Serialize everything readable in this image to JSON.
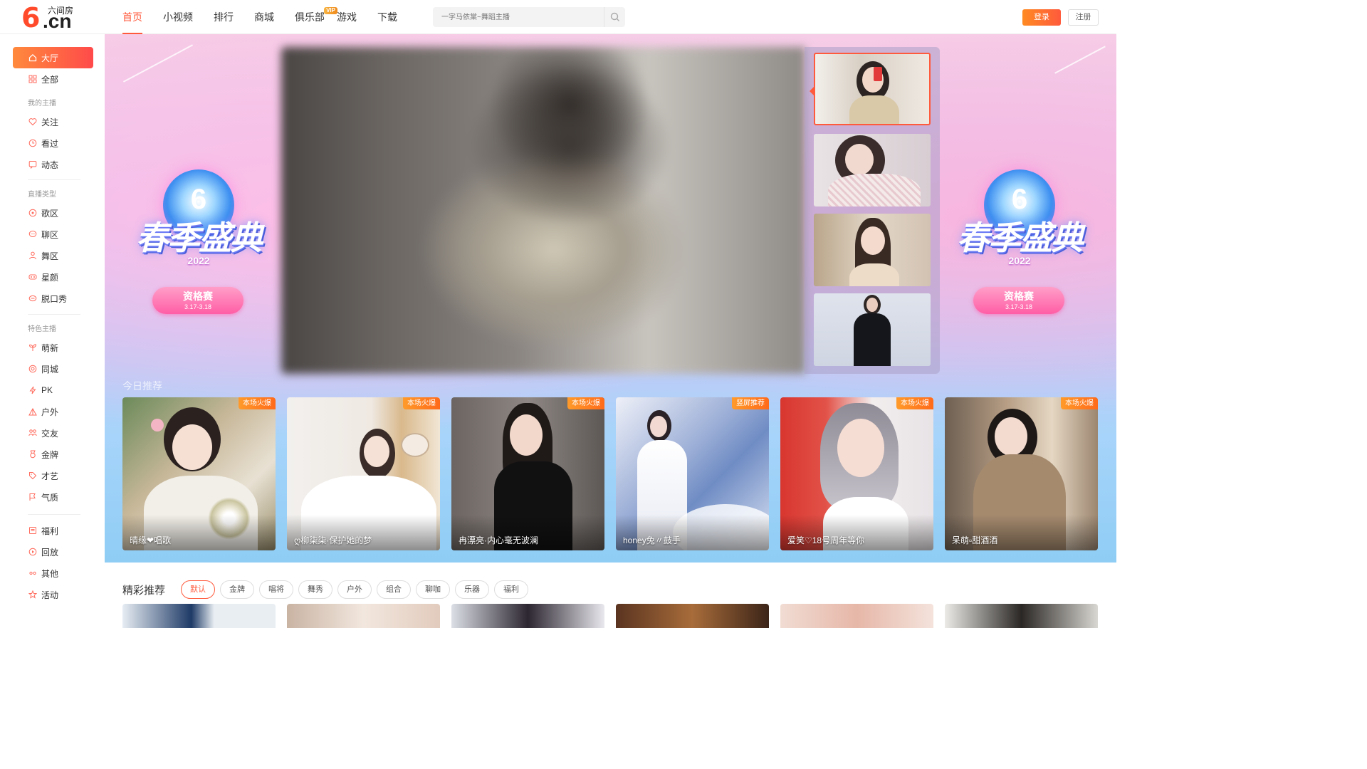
{
  "header": {
    "logo_brand": "六间房",
    "logo_six": "6",
    "logo_cn": ".cn",
    "nav": [
      {
        "label": "首页",
        "active": true
      },
      {
        "label": "小视频"
      },
      {
        "label": "排行"
      },
      {
        "label": "商城"
      },
      {
        "label": "俱乐部",
        "badge": "VIP"
      },
      {
        "label": "游戏"
      },
      {
        "label": "下载"
      }
    ],
    "search_placeholder": "一字马依棠~舞蹈主播",
    "login_label": "登录",
    "register_label": "注册"
  },
  "sidebar": {
    "hall": "大厅",
    "all": "全部",
    "section_my": "我的主播",
    "my_items": [
      "关注",
      "看过",
      "动态"
    ],
    "section_type": "直播类型",
    "type_items": [
      "歌区",
      "聊区",
      "舞区",
      "星颜",
      "脱口秀"
    ],
    "section_feature": "特色主播",
    "feature_items": [
      "萌新",
      "同城",
      "PK",
      "户外",
      "交友",
      "金牌",
      "才艺",
      "气质"
    ],
    "other_items": [
      "福利",
      "回放",
      "其他",
      "活动"
    ]
  },
  "banner": {
    "event_title": "春季盛典",
    "event_year": "2022",
    "event_stage": "资格赛",
    "event_dates": "3.17-3.18"
  },
  "recommend": {
    "title": "今日推荐",
    "cards": [
      {
        "badge": "本场火爆",
        "name": "晴缘❤唱歌"
      },
      {
        "badge": "本场火爆",
        "name": "ღ柳柒柒·保护她的梦"
      },
      {
        "badge": "本场火爆",
        "name": "冉漂亮·内心毫无波澜"
      },
      {
        "badge": "竖屏推荐",
        "name": "honey兔〃鼓手"
      },
      {
        "badge": "本场火爆",
        "name": "爱笑♡18号周年等你"
      },
      {
        "badge": "本场火爆",
        "name": "呆萌▫甜酒酒"
      }
    ]
  },
  "featured": {
    "title": "精彩推荐",
    "filters": [
      "默认",
      "金牌",
      "唱将",
      "舞秀",
      "户外",
      "组合",
      "聊咖",
      "乐器",
      "福利"
    ]
  },
  "colors": {
    "accent": "#ff5a3c",
    "badge_orange": "#ff7a22"
  }
}
